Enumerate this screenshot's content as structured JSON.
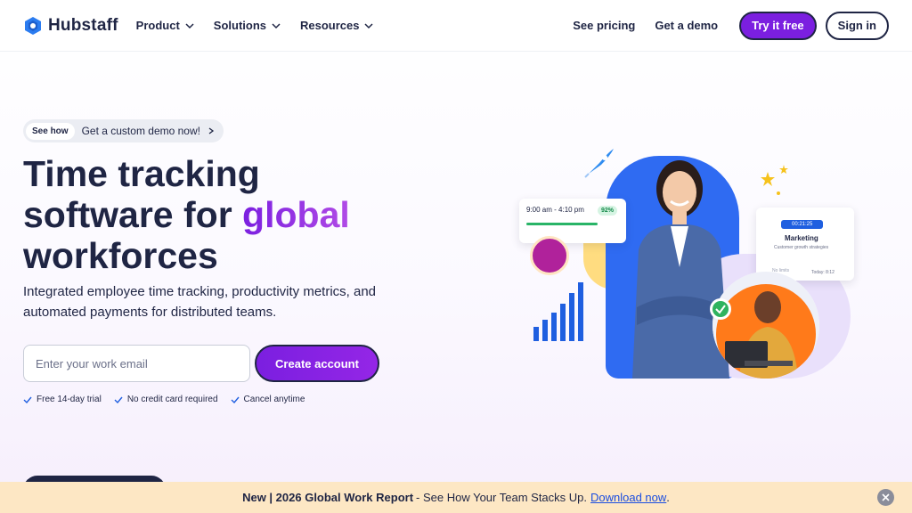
{
  "nav": {
    "logo_text": "Hubstaff",
    "menu": [
      {
        "label": "Product"
      },
      {
        "label": "Solutions"
      },
      {
        "label": "Resources"
      }
    ],
    "see_pricing": "See pricing",
    "get_demo": "Get a demo",
    "try_free": "Try it free",
    "sign_in": "Sign in"
  },
  "hero": {
    "pill_tag": "See how",
    "pill_text": "Get a custom demo now!",
    "headline_line1": "Time tracking",
    "headline_line2_a": "software for ",
    "headline_line2_accent": "global",
    "headline_line3": "workforces",
    "subtitle": "Integrated employee time tracking, productivity metrics, and automated payments for distributed teams.",
    "email_placeholder": "Enter your work email",
    "create_button": "Create account",
    "perks": [
      "Free 14-day trial",
      "No credit card required",
      "Cancel anytime"
    ]
  },
  "illustration": {
    "time_range": "9:00 am - 4:10 pm",
    "percent": "92%",
    "timer": "00:21:25",
    "card_title": "Marketing",
    "card_subtitle": "Customer growth strategies",
    "card_today": "Today: 8:12",
    "card_limits": "No limits"
  },
  "banner": {
    "bold": "New | 2026 Global Work Report",
    "text": " - See How Your Team Stacks Up.",
    "link": "Download now",
    "end": "."
  },
  "colors": {
    "brand_purple": "#7b1fe0",
    "navy": "#1f2544",
    "banner_bg": "#fde7c4",
    "link_blue": "#1a4de0"
  }
}
